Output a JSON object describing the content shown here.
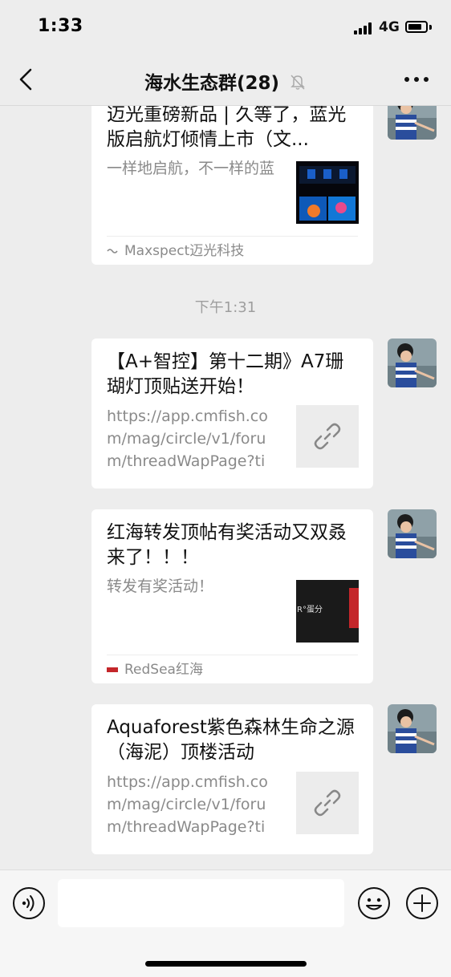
{
  "status_bar": {
    "time": "1:33",
    "network": "4G"
  },
  "nav": {
    "title": "海水生态群(28)"
  },
  "colors": {
    "background": "#ededed",
    "card": "#ffffff",
    "muted_text": "#8a8a8a",
    "input_bar": "#f6f6f6"
  },
  "icons": [
    "back-chevron-icon",
    "mute-bell-icon",
    "more-icon",
    "link-icon",
    "voice-icon",
    "emoji-icon",
    "plus-icon"
  ],
  "messages": [
    {
      "title": "迈光重磅新品 | 久等了，蓝光版启航灯倾情上市（文...",
      "description": "一样地启航，不一样的蓝",
      "source": "Maxspect迈光科技"
    },
    {
      "title": "【A+智控】第十二期》A7珊 瑚灯顶贴送开始！",
      "description": "https://app.cmfish.com/mag/circle/v1/forum/threadWapPage?tid..."
    },
    {
      "title": "红海转发顶帖有奖活动又双叒来了！！！",
      "description": "转发有奖活动！",
      "source": "RedSea红海",
      "thumb_text": "R°蛋分"
    },
    {
      "title": "Aquaforest紫色森林生命之源（海泥）顶楼活动",
      "description": "https://app.cmfish.com/mag/circle/v1/forum/threadWapPage?tid..."
    }
  ],
  "time_separator": "下午1:31"
}
